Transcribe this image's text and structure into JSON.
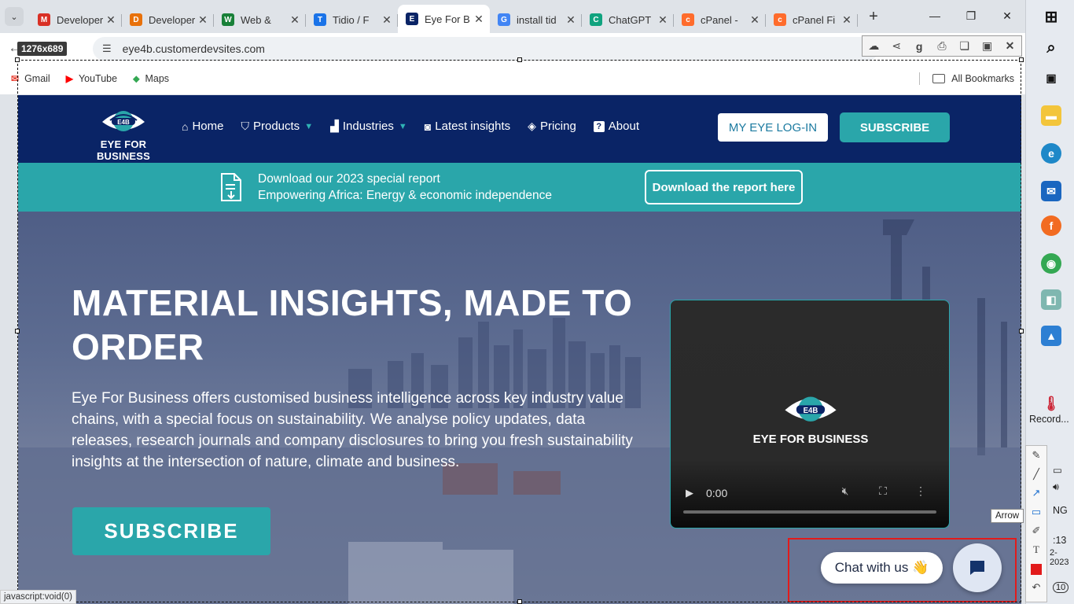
{
  "browser": {
    "tabs": [
      {
        "title": "Developer",
        "favicon": "M",
        "color": "#d93025"
      },
      {
        "title": "Developer",
        "favicon": "D",
        "color": "#e8710a"
      },
      {
        "title": "Web & ",
        "favicon": "W",
        "color": "#188038"
      },
      {
        "title": "Tidio / F",
        "favicon": "T",
        "color": "#1a73e8"
      },
      {
        "title": "Eye For B",
        "favicon": "E",
        "color": "#0a2466"
      },
      {
        "title": "install tid",
        "favicon": "G",
        "color": "#4285f4"
      },
      {
        "title": "ChatGPT",
        "favicon": "C",
        "color": "#10a37f"
      },
      {
        "title": "cPanel - ",
        "favicon": "c",
        "color": "#ff6c2c"
      },
      {
        "title": "cPanel Fi",
        "favicon": "c",
        "color": "#ff6c2c"
      }
    ],
    "url": "eye4b.customerdevsites.com",
    "size_badge": "1276x689",
    "bookmarks": [
      {
        "label": "Gmail",
        "icon": "gmail-icon"
      },
      {
        "label": "YouTube",
        "icon": "youtube-icon"
      },
      {
        "label": "Maps",
        "icon": "maps-icon"
      }
    ],
    "all_bookmarks": "All Bookmarks"
  },
  "site": {
    "logo_text": "EYE FOR BUSINESS",
    "nav": {
      "home": "Home",
      "products": "Products",
      "industries": "Industries",
      "latest": "Latest insights",
      "pricing": "Pricing",
      "about": "About"
    },
    "login_button": "MY EYE LOG-IN",
    "subscribe_button": "SUBSCRIBE",
    "banner": {
      "line1": "Download our 2023 special report",
      "line2": "Empowering Africa: Energy & economic independence",
      "button": "Download the report here"
    },
    "hero": {
      "title": "MATERIAL INSIGHTS, MADE TO ORDER",
      "description": "Eye For Business offers customised business intelligence across key industry value chains, with a special focus on sustainability. We analyse policy updates, data releases, research journals and company disclosures to bring you fresh sustainability insights at the intersection of nature, climate and business.",
      "subscribe": "SUBSCRIBE"
    },
    "video": {
      "brand": "EYE FOR BUSINESS",
      "time": "0:00"
    },
    "chat": {
      "label": "Chat with us 👋"
    }
  },
  "overlay": {
    "tooltip": "Arrow",
    "status": "javascript:void(0)"
  },
  "taskbar": {
    "record_label": "Record...",
    "lang": "NG",
    "time_fragment": ":13",
    "date_fragment": "2-2023",
    "notif_count": "10"
  },
  "colors": {
    "navy": "#0a2466",
    "teal": "#2aa6aa",
    "annotation_red": "#e21b1b"
  }
}
